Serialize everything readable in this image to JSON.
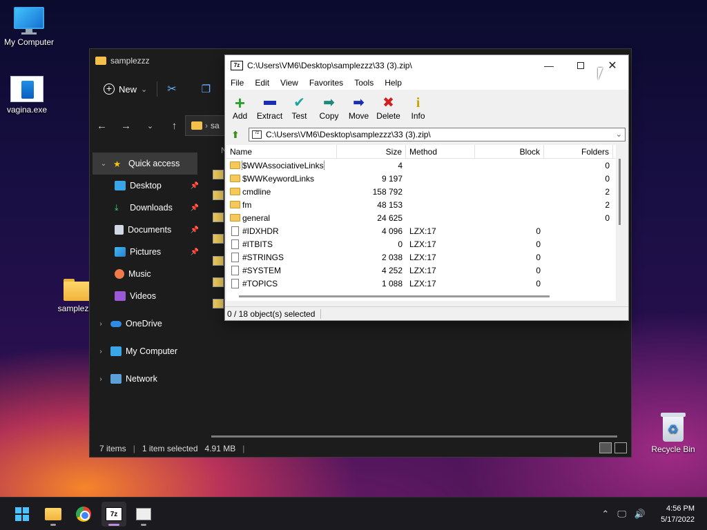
{
  "desktop": {
    "icons": [
      {
        "label": "My Computer",
        "icon": "computer-icon"
      },
      {
        "label": "vagina.exe",
        "icon": "exe-icon"
      },
      {
        "label": "samplezzz",
        "icon": "folder-icon"
      },
      {
        "label": "Recycle Bin",
        "icon": "recycle-bin-icon"
      }
    ]
  },
  "explorer": {
    "title": "samplezzz",
    "toolbar": {
      "new_label": "New",
      "chevron": "⌄"
    },
    "address_fragment": "sa",
    "nav": [
      {
        "label": "Quick access",
        "icon": "star-icon",
        "selected": true
      },
      {
        "label": "Desktop",
        "icon": "desktop-icon",
        "pinned": true
      },
      {
        "label": "Downloads",
        "icon": "download-icon",
        "pinned": true
      },
      {
        "label": "Documents",
        "icon": "documents-icon",
        "pinned": true
      },
      {
        "label": "Pictures",
        "icon": "pictures-icon",
        "pinned": true
      },
      {
        "label": "Music",
        "icon": "music-icon"
      },
      {
        "label": "Videos",
        "icon": "videos-icon"
      },
      {
        "label": "OneDrive",
        "icon": "cloud-icon"
      },
      {
        "label": "My Computer",
        "icon": "computer-icon"
      },
      {
        "label": "Network",
        "icon": "network-icon"
      }
    ],
    "column_letter": "N",
    "status": {
      "items": "7 items",
      "selected": "1 item selected",
      "size": "4.91 MB"
    }
  },
  "sevenzip": {
    "title": "C:\\Users\\VM6\\Desktop\\samplezzz\\33 (3).zip\\",
    "menu": [
      "File",
      "Edit",
      "View",
      "Favorites",
      "Tools",
      "Help"
    ],
    "tools": [
      {
        "label": "Add",
        "icon": "add-icon",
        "color": "#2ca02c"
      },
      {
        "label": "Extract",
        "icon": "extract-icon",
        "color": "#1a2fb0"
      },
      {
        "label": "Test",
        "icon": "test-icon",
        "color": "#1aa6a6"
      },
      {
        "label": "Copy",
        "icon": "copy-icon",
        "color": "#1a8a7a"
      },
      {
        "label": "Move",
        "icon": "move-icon",
        "color": "#1a2fb0"
      },
      {
        "label": "Delete",
        "icon": "delete-icon",
        "color": "#d21f1f"
      },
      {
        "label": "Info",
        "icon": "info-icon",
        "color": "#c9a400"
      }
    ],
    "path": "C:\\Users\\VM6\\Desktop\\samplezzz\\33 (3).zip\\",
    "columns": {
      "name": "Name",
      "size": "Size",
      "method": "Method",
      "block": "Block",
      "folders": "Folders"
    },
    "rows": [
      {
        "name": "$WWAssociativeLinks",
        "type": "folder",
        "size": "4",
        "method": "",
        "block": "",
        "folders": "0"
      },
      {
        "name": "$WWKeywordLinks",
        "type": "folder",
        "size": "9 197",
        "method": "",
        "block": "",
        "folders": "0"
      },
      {
        "name": "cmdline",
        "type": "folder",
        "size": "158 792",
        "method": "",
        "block": "",
        "folders": "2"
      },
      {
        "name": "fm",
        "type": "folder",
        "size": "48 153",
        "method": "",
        "block": "",
        "folders": "2"
      },
      {
        "name": "general",
        "type": "folder",
        "size": "24 625",
        "method": "",
        "block": "",
        "folders": "0"
      },
      {
        "name": "#IDXHDR",
        "type": "file",
        "size": "4 096",
        "method": "LZX:17",
        "block": "0",
        "folders": ""
      },
      {
        "name": "#ITBITS",
        "type": "file",
        "size": "0",
        "method": "LZX:17",
        "block": "0",
        "folders": ""
      },
      {
        "name": "#STRINGS",
        "type": "file",
        "size": "2 038",
        "method": "LZX:17",
        "block": "0",
        "folders": ""
      },
      {
        "name": "#SYSTEM",
        "type": "file",
        "size": "4 252",
        "method": "LZX:17",
        "block": "0",
        "folders": ""
      },
      {
        "name": "#TOPICS",
        "type": "file",
        "size": "1 088",
        "method": "LZX:17",
        "block": "0",
        "folders": ""
      }
    ],
    "status": "0 / 18 object(s) selected"
  },
  "taskbar": {
    "apps": [
      {
        "name": "start-button"
      },
      {
        "name": "file-explorer-button"
      },
      {
        "name": "chrome-button"
      },
      {
        "name": "7zip-button",
        "label": "7z",
        "active": true
      },
      {
        "name": "app-window-button"
      }
    ],
    "time": "4:56 PM",
    "date": "5/17/2022"
  }
}
